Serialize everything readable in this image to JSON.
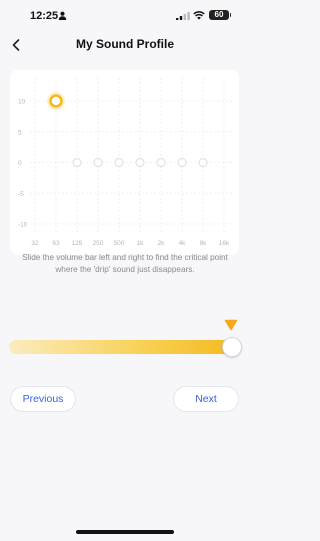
{
  "status_bar": {
    "time": "12:25",
    "battery": "60"
  },
  "header": {
    "title": "My Sound Profile",
    "back_icon": "chevron-left-icon"
  },
  "chart_data": {
    "type": "scatter",
    "categories": [
      "32",
      "63",
      "125",
      "250",
      "500",
      "1k",
      "2k",
      "4k",
      "8k",
      "16k"
    ],
    "y_ticks": [
      10,
      5,
      0,
      -5,
      -10
    ],
    "ylim": [
      -10,
      10
    ],
    "grid": true,
    "points": [
      {
        "x": "63",
        "y": 10,
        "state": "active"
      },
      {
        "x": "125",
        "y": 0,
        "state": "inactive"
      },
      {
        "x": "250",
        "y": 0,
        "state": "inactive"
      },
      {
        "x": "500",
        "y": 0,
        "state": "inactive"
      },
      {
        "x": "1k",
        "y": 0,
        "state": "inactive"
      },
      {
        "x": "2k",
        "y": 0,
        "state": "inactive"
      },
      {
        "x": "4k",
        "y": 0,
        "state": "inactive"
      },
      {
        "x": "8k",
        "y": 0,
        "state": "inactive"
      }
    ],
    "colors": {
      "active": "#f5b91e",
      "inactive": "#e2e2e2",
      "grid": "#ececec",
      "label": "#b5b5b5"
    }
  },
  "instruction": "Slide the volume bar left and right to find the critical point where the 'drip' sound just disappears.",
  "slider": {
    "value_fraction": 1.0,
    "marker_color": "#f5a81e"
  },
  "buttons": {
    "previous": "Previous",
    "next": "Next"
  }
}
